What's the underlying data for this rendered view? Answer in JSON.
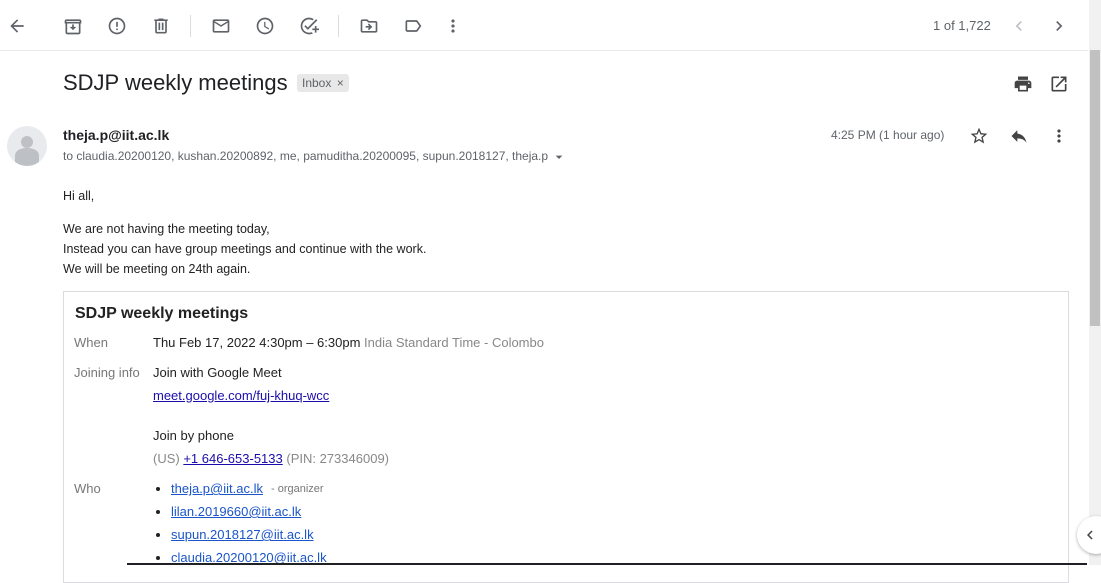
{
  "toolbar": {
    "pagination": "1 of 1,722"
  },
  "email": {
    "subject": "SDJP weekly meetings",
    "label": "Inbox",
    "label_close": "×",
    "sender": "theja.p@iit.ac.lk",
    "recipients": "to claudia.20200120, kushan.20200892, me, pamuditha.20200095, supun.2018127, theja.p",
    "time": "4:25 PM (1 hour ago)",
    "greeting": "Hi all,",
    "lines": [
      "We are not having the meeting today,",
      "Instead you can have group meetings and continue with the work.",
      "We will be meeting on 24th again."
    ]
  },
  "invite": {
    "title": "SDJP weekly meetings",
    "when_label": "When",
    "when_value": "Thu Feb 17, 2022 4:30pm – 6:30pm",
    "when_tz": "India Standard Time - Colombo",
    "joining_label": "Joining info",
    "join_meet": "Join with Google Meet",
    "meet_link": "meet.google.com/fuj-khuq-wcc",
    "join_phone": "Join by phone",
    "phone_country": "(US)",
    "phone_number": "+1 646-653-5133",
    "phone_pin": "(PIN: 273346009)",
    "who_label": "Who",
    "who": [
      {
        "email": "theja.p@iit.ac.lk",
        "role": "- organizer"
      },
      {
        "email": "lilan.2019660@iit.ac.lk"
      },
      {
        "email": "supun.2018127@iit.ac.lk"
      },
      {
        "email": "claudia.20200120@iit.ac.lk"
      }
    ]
  },
  "icons": [
    "back-arrow-icon",
    "archive-icon",
    "report-spam-icon",
    "delete-icon",
    "mark-unread-icon",
    "snooze-icon",
    "add-task-icon",
    "move-to-icon",
    "label-icon",
    "more-vert-icon",
    "chevron-left-icon",
    "chevron-right-icon",
    "print-icon",
    "open-new-window-icon",
    "star-icon",
    "reply-icon",
    "avatar-icon",
    "dropdown-icon"
  ]
}
